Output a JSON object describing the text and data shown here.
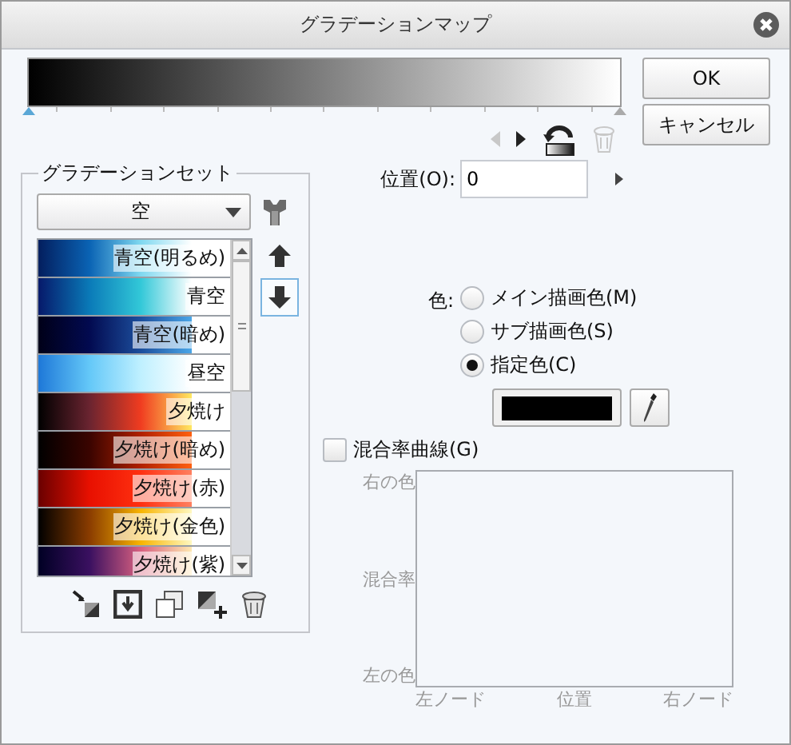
{
  "window": {
    "title": "グラデーションマップ"
  },
  "nodes": [
    {
      "selected": true
    },
    {
      "selected": false
    }
  ],
  "nav_buttons": [
    {
      "kind": "prev",
      "disabled": true
    },
    {
      "kind": "next",
      "disabled": false
    },
    {
      "kind": "reverse",
      "disabled": false
    },
    {
      "kind": "delete",
      "disabled": true
    }
  ],
  "buttons": [
    "OK",
    "キャンセル"
  ],
  "gradient_set": {
    "title": "グラデーションセット",
    "dropdown": "空",
    "items": [
      {
        "name": "青空(明るめ)"
      },
      {
        "name": "青空"
      },
      {
        "name": "青空(暗め)"
      },
      {
        "name": "昼空"
      },
      {
        "name": "夕焼け"
      },
      {
        "name": "夕焼け(暗め)"
      },
      {
        "name": "夕焼け(赤)"
      },
      {
        "name": "夕焼け(金色)"
      },
      {
        "name": "夕焼け(紫)"
      }
    ]
  },
  "position": {
    "label": "位置(O):",
    "value": "0"
  },
  "color": {
    "label": "色:",
    "options": [
      {
        "label": "メイン描画色(M)",
        "selected": false
      },
      {
        "label": "サブ描画色(S)",
        "selected": false
      },
      {
        "label": "指定色(C)",
        "selected": true
      }
    ]
  },
  "blend_curve": {
    "label": "混合率曲線(G)",
    "checked": false,
    "disabled": true,
    "y_labels": [
      "右の色",
      "混合率",
      "左の色"
    ],
    "x_labels": [
      "左ノード",
      "位置",
      "右ノード"
    ]
  }
}
